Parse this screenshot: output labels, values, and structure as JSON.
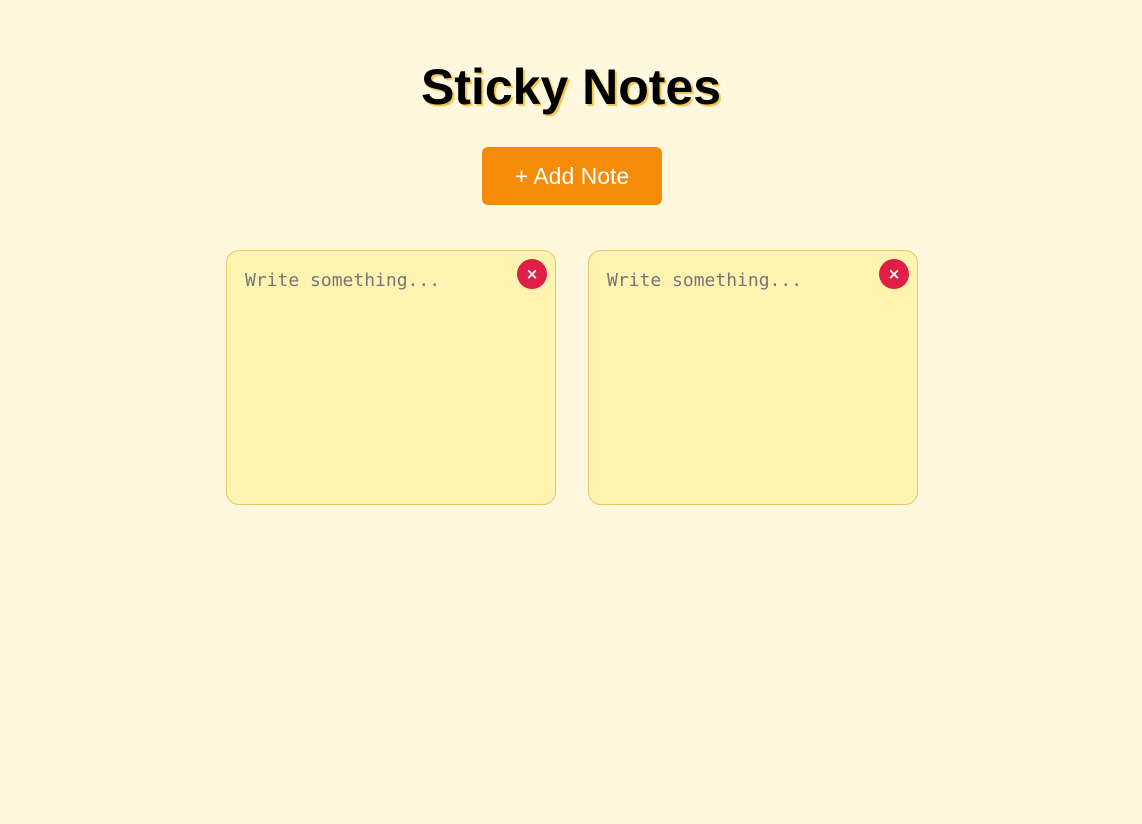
{
  "header": {
    "title": "Sticky Notes"
  },
  "toolbar": {
    "add_note_label": "+ Add Note"
  },
  "notes": [
    {
      "placeholder": "Write something...",
      "value": "",
      "delete_label": "×"
    },
    {
      "placeholder": "Write something...",
      "value": "",
      "delete_label": "×"
    }
  ],
  "colors": {
    "page_background": "#fff8df",
    "note_background": "#fff3b0",
    "note_border": "#e9c766",
    "add_button": "#f58b07",
    "delete_button": "#df1f45"
  }
}
